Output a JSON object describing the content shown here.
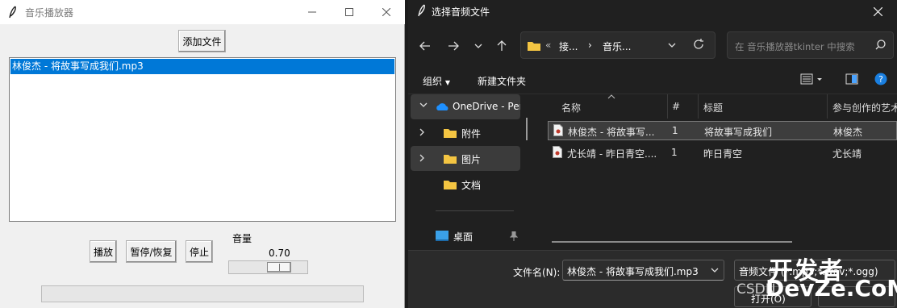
{
  "player": {
    "title": "音乐播放器",
    "add_button": "添加文件",
    "playlist": [
      "林俊杰 - 将故事写成我们.mp3"
    ],
    "play_button": "播放",
    "pause_button": "暂停/恢复",
    "stop_button": "停止",
    "volume_label": "音量",
    "volume_value": "0.70",
    "volume": 0.7,
    "progress": 0.0
  },
  "dialog": {
    "title": "选择音频文件",
    "breadcrumb_prefix": "«",
    "breadcrumb_1": "接...",
    "breadcrumb_sep": "›",
    "breadcrumb_2": "音乐...",
    "search_placeholder": "在 音乐播放器tkinter 中搜索",
    "organize": "组织",
    "new_folder": "新建文件夹",
    "nav": {
      "onedrive": "OneDrive - Per",
      "attachments": "附件",
      "pictures": "图片",
      "documents": "文档",
      "desktop": "桌面"
    },
    "columns": {
      "name": "名称",
      "number": "#",
      "title": "标题",
      "artist": "参与创作的艺术"
    },
    "files": [
      {
        "name": "林俊杰 - 将故事写...",
        "number": "1",
        "title": "将故事写成我们",
        "artist": "林俊杰"
      },
      {
        "name": "尤长靖 - 昨日青空....",
        "number": "1",
        "title": "昨日青空",
        "artist": "尤长靖"
      }
    ],
    "filename_label": "文件名(N):",
    "filename_value": "林俊杰 - 将故事写成我们.mp3",
    "filetype_value": "音频文件 (*.mp3;*.wav;*.ogg)",
    "open_button": "打开(O)"
  },
  "watermark": {
    "line1": "开发者",
    "line2": "DevZe.CoM",
    "prefix": "CSDN"
  },
  "colors": {
    "selection_blue": "#0078d7",
    "dark_bg": "#202020",
    "folder_yellow": "#f4c542",
    "onedrive_blue": "#1e90ff"
  }
}
